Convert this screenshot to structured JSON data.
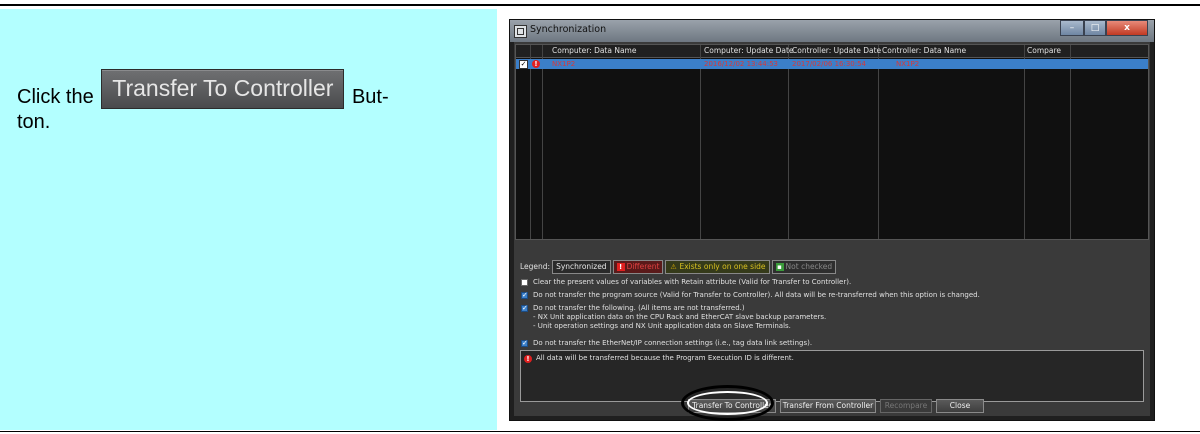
{
  "instruction": {
    "prefix": "Click the",
    "button_caption": "Transfer To Controller",
    "suffix": "But-\nton."
  },
  "window": {
    "title": "Synchronization",
    "controls": {
      "minimize": "–",
      "maximize": "□",
      "close": "x"
    }
  },
  "grid": {
    "columns": [
      "Computer: Data Name",
      "Computer: Update Date",
      "Controller: Update Date",
      "Controller: Data Name",
      "Compare"
    ],
    "rows": [
      {
        "checked": true,
        "status": "!",
        "computer_name": "NX1P2",
        "computer_date": "2016/12/02 13:44:53",
        "controller_date": "2017/02/06 16:30:54",
        "controller_name": "NX1P2",
        "compare": ""
      }
    ]
  },
  "legend": {
    "label": "Legend:",
    "items": [
      {
        "text": "Synchronized",
        "icon": ""
      },
      {
        "text": "Different",
        "icon": "!"
      },
      {
        "text": "Exists only on one side",
        "icon": "⚠"
      },
      {
        "text": "Not checked",
        "icon": "▪"
      }
    ]
  },
  "options": [
    {
      "checked": false,
      "text": "Clear the present values of variables with Retain attribute (Valid for Transfer to Controller)."
    },
    {
      "checked": true,
      "text": "Do not transfer the program source (Valid for Transfer to Controller). All data will be re-transferred when this option is changed."
    },
    {
      "checked": true,
      "text": "Do not transfer the following. (All items are not transferred.)",
      "sub": [
        "- NX Unit application data on the CPU Rack and EtherCAT slave backup parameters.",
        "- Unit operation settings and NX Unit application data on Slave Terminals."
      ]
    },
    {
      "checked": true,
      "text": "Do not transfer the EtherNet/IP connection settings (i.e., tag data link settings)."
    }
  ],
  "message": {
    "icon": "!",
    "text": "All data will be transferred because the Program Execution ID is different."
  },
  "buttons": {
    "transfer_to": "Transfer To Controller",
    "transfer_from": "Transfer From Controller",
    "recompare": "Recompare",
    "close": "Close"
  }
}
